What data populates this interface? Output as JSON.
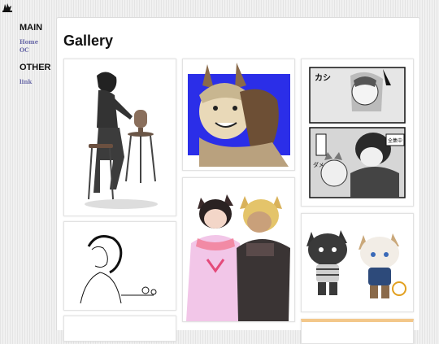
{
  "sidebar": {
    "main_heading": "MAIN",
    "main_links": [
      "Home",
      "OC"
    ],
    "other_heading": "OTHER",
    "other_links": [
      "link"
    ]
  },
  "gallery": {
    "title": "Gallery",
    "images": [
      "man-sitting-on-stool-with-bust-sculpture",
      "smiling-cat-eared-character-on-blue-background",
      "manga-page-cat-eared-characters",
      "lineart-woman-sketch",
      "two-cat-eared-characters-embracing",
      "chibi-cat-pair-holding-hands"
    ]
  },
  "manga_text": {
    "sfx_top": "カシ",
    "bubble": "全集中",
    "side": "ダメ"
  },
  "colors": {
    "link": "#6a6aa8",
    "blue_bg": "#2b2ee8",
    "peach_border": "#f3c78a"
  }
}
